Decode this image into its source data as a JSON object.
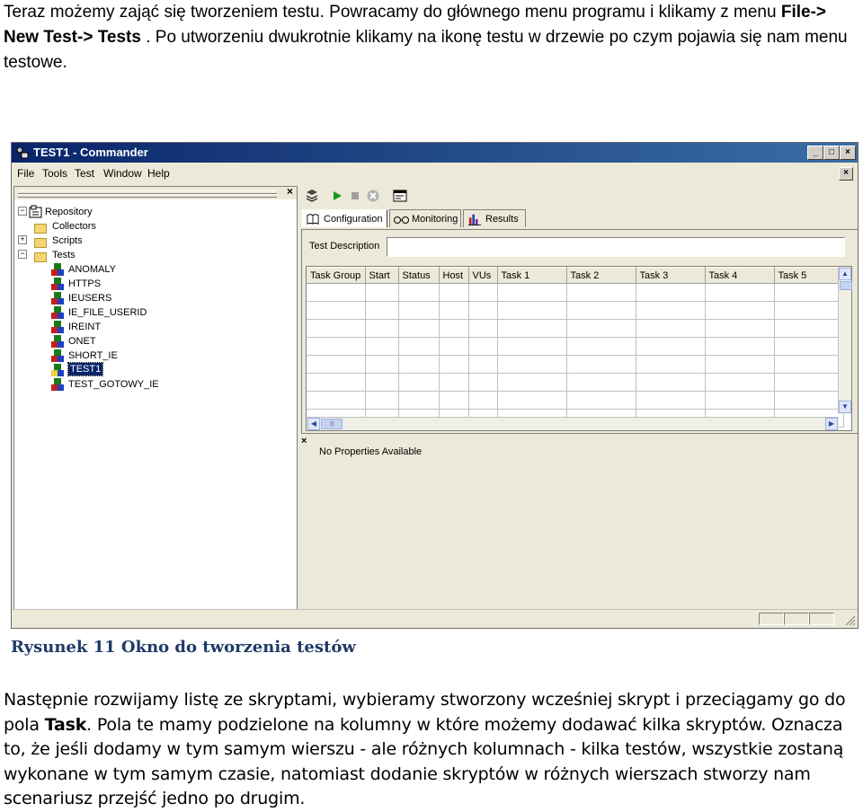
{
  "intro": {
    "part1": "Teraz możemy zająć się tworzeniem testu. Powracamy do głównego menu programu i klikamy z menu ",
    "menu_path": "File-> New Test-> Tests",
    "part2": " . Po utworzeniu dwukrotnie klikamy na ikonę testu w drzewie po czym pojawia się nam menu testowe."
  },
  "window": {
    "title": "TEST1 - Commander",
    "title_buttons": [
      "_",
      "□",
      "×"
    ],
    "mdi_close": "×",
    "menu": [
      "File",
      "Tools",
      "Test",
      "Window",
      "Help"
    ]
  },
  "repository": {
    "close": "×",
    "root": "Repository",
    "folders": [
      "Collectors",
      "Scripts",
      "Tests"
    ],
    "expanders": [
      "−",
      "+",
      "−"
    ],
    "tests": [
      "ANOMALY",
      "HTTPS",
      "IEUSERS",
      "IE_FILE_USERID",
      "IREINT",
      "ONET",
      "SHORT_IE",
      "TEST1",
      "TEST_GOTOWY_IE"
    ],
    "selected": "TEST1"
  },
  "toolbar": {
    "icons": [
      "save-icon",
      "play-icon",
      "stop-icon",
      "abort-icon",
      "window-icon"
    ]
  },
  "tabs": [
    "Configuration",
    "Monitoring",
    "Results"
  ],
  "config": {
    "test_description_label": "Test Description",
    "test_description_value": "",
    "columns": [
      "Task Group",
      "Start",
      "Status",
      "Host",
      "VUs",
      "Task 1",
      "Task 2",
      "Task 3",
      "Task 4",
      "Task 5"
    ]
  },
  "scroll": {
    "up": "▲",
    "down": "▼",
    "left": "◀",
    "right": "▶",
    "thumb": "|||"
  },
  "properties": {
    "close": "×",
    "message": "No Properties Available"
  },
  "caption": "Rysunek 11 Okno do tworzenia testów",
  "body": {
    "part1": "Następnie rozwijamy listę ze skryptami, wybieramy stworzony wcześniej skrypt i przeciągamy go do pola ",
    "task_word": "Task",
    "part2": ". Pola te mamy podzielone na kolumny w które możemy dodawać kilka skryptów. Oznacza to, że jeśli dodamy w tym samym wierszu - ale różnych kolumnach - kilka testów, wszystkie zostaną wykonane w tym samym czasie, natomiast dodanie skryptów w różnych wierszach stworzy nam scenariusz przejść jedno po drugim."
  }
}
